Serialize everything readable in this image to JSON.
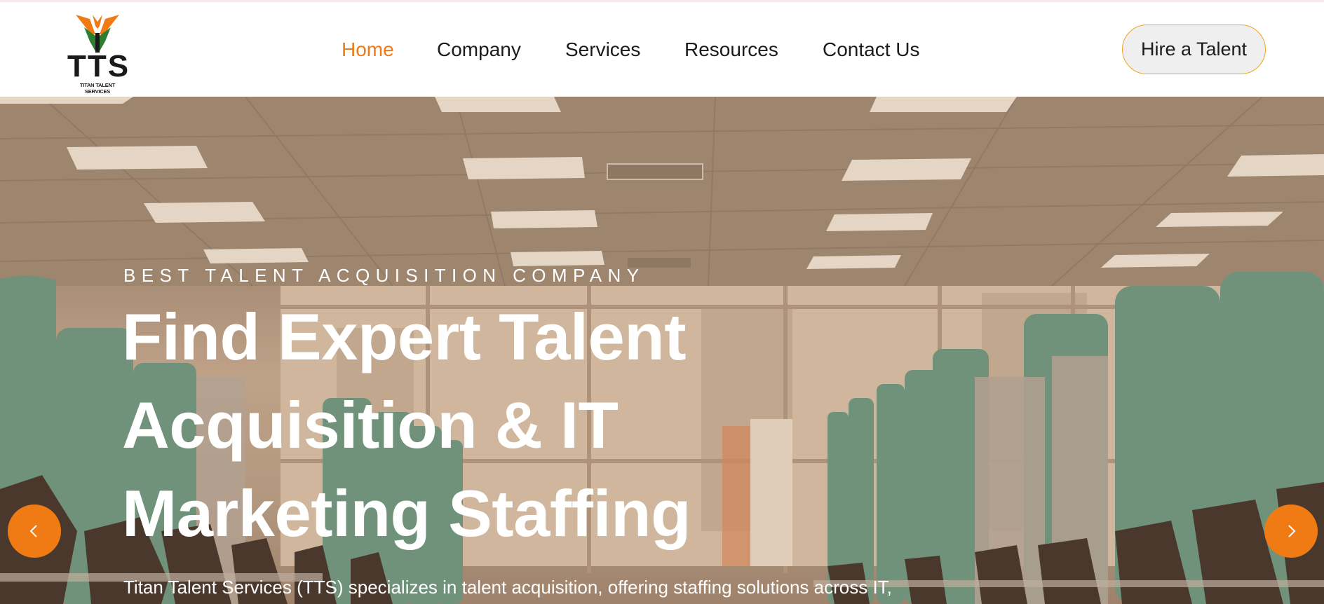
{
  "logo": {
    "text": "TTS",
    "subtext": "TITAN TALENT SERVICES"
  },
  "nav": {
    "items": [
      {
        "label": "Home",
        "active": true
      },
      {
        "label": "Company",
        "active": false
      },
      {
        "label": "Services",
        "active": false
      },
      {
        "label": "Resources",
        "active": false
      },
      {
        "label": "Contact Us",
        "active": false
      }
    ]
  },
  "header": {
    "cta_label": "Hire a Talent"
  },
  "hero": {
    "eyebrow": "BEST TALENT ACQUISITION COMPANY",
    "headline": [
      "Find Expert Talent",
      "Acquisition & IT",
      "Marketing Staffing"
    ],
    "subtext": "Titan Talent Services (TTS) specializes in talent acquisition, offering staffing solutions across IT,"
  },
  "carousel": {
    "prev_icon": "chevron-left-icon",
    "next_icon": "chevron-right-icon"
  },
  "colors": {
    "accent": "#f07a14",
    "button_border": "#f0a422",
    "text": "#1c1c1c",
    "hero_text": "#ffffff"
  }
}
